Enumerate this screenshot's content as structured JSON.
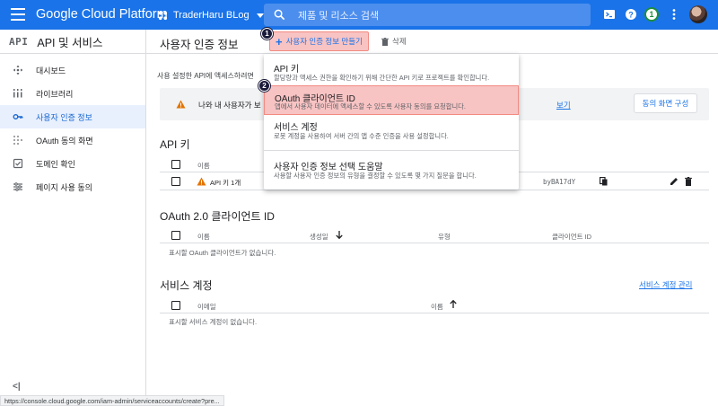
{
  "topbar": {
    "brand": "Google Cloud Platform",
    "project": "TraderHaru BLog",
    "search_placeholder": "제품 및 리소스 검색",
    "notification_count": "1",
    "color": "#1a73e8"
  },
  "sidebar": {
    "api_badge": "API",
    "title": "API 및 서비스",
    "items": [
      {
        "label": "대시보드",
        "icon": "dashboard-icon"
      },
      {
        "label": "라이브러리",
        "icon": "library-icon"
      },
      {
        "label": "사용자 인증 정보",
        "icon": "key-icon",
        "active": true
      },
      {
        "label": "OAuth 동의 화면",
        "icon": "oauth-consent-icon"
      },
      {
        "label": "도메인 확인",
        "icon": "domain-check-icon"
      },
      {
        "label": "페이지 사용 동의",
        "icon": "page-usage-icon"
      }
    ],
    "collapse": "<|"
  },
  "main": {
    "title": "사용자 인증 정보",
    "create_label": "사용자 인증 정보 만들기",
    "delete_label": "삭제",
    "intro": "사용 설정한 API에 액세스하려면",
    "notice": {
      "text": "나와 내 사용자가 보",
      "link": "보기",
      "button": "동의 화면 구성"
    },
    "api_keys": {
      "title": "API 키",
      "col_name": "이름",
      "rows": [
        {
          "name": "API 키 1개",
          "key_suffix": "byBA17dY"
        }
      ]
    },
    "oauth": {
      "title": "OAuth 2.0 클라이언트 ID",
      "cols": [
        "이름",
        "생성일",
        "유형",
        "클라이언트 ID"
      ],
      "empty": "표시할 OAuth 클라이언트가 없습니다."
    },
    "service_accounts": {
      "title": "서비스 계정",
      "manage_link": "서비스 계정 관리",
      "cols": [
        "이메일",
        "이름"
      ],
      "empty": "표시할 서비스 계정이 없습니다."
    }
  },
  "menu": {
    "items": [
      {
        "title": "API 키",
        "desc": "할당량과 액세스 권한을 확인하기 위해 간단한 API 키로 프로젝트를 확인합니다."
      },
      {
        "title": "OAuth 클라이언트 ID",
        "desc": "앱에서 사용자 데이터에 액세스할 수 있도록 사용자 동의를 요청합니다.",
        "highlighted": true
      },
      {
        "title": "서비스 계정",
        "desc": "로봇 계정을 사용하여 서버 간의 앱 수준 인증을 사용 설정합니다."
      },
      {
        "title": "사용자 인증 정보 선택 도움말",
        "desc": "사용할 사용자 인증 정보의 유형을 결정할 수 있도록 몇 가지 질문을 합니다."
      }
    ]
  },
  "steps": [
    "1",
    "2"
  ],
  "status_url": "https://console.cloud.google.com/iam-admin/serviceaccounts/create?pre..."
}
